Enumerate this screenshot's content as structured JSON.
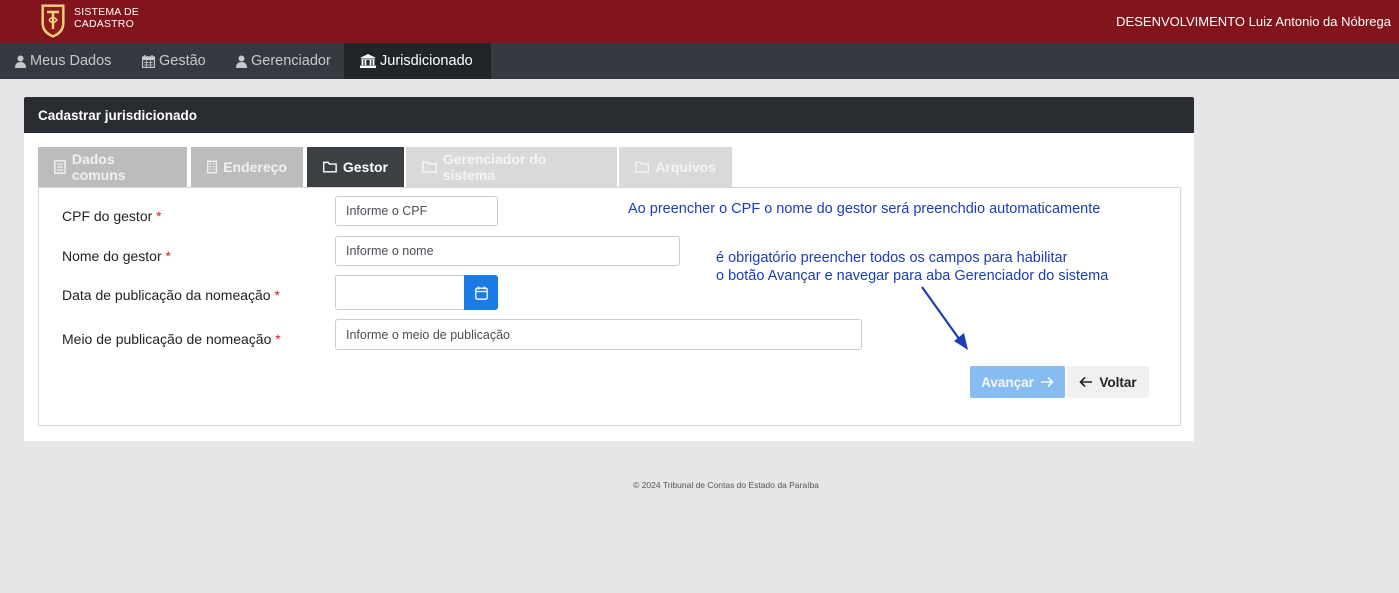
{
  "header": {
    "system_line1": "SISTEMA DE",
    "system_line2": "CADASTRO",
    "user": "DESENVOLVIMENTO Luiz Antonio da Nóbrega"
  },
  "nav": {
    "items": [
      {
        "label": "Meus Dados",
        "icon": "user-icon"
      },
      {
        "label": "Gestão",
        "icon": "calendar-icon"
      },
      {
        "label": "Gerenciador",
        "icon": "user-icon"
      },
      {
        "label": "Jurisdicionado",
        "icon": "bank-icon",
        "active": true
      }
    ]
  },
  "card": {
    "title": "Cadastrar jurisdicionado"
  },
  "tabs": [
    {
      "label": "Dados comuns",
      "icon": "document-icon"
    },
    {
      "label": "Endereço",
      "icon": "building-icon"
    },
    {
      "label": "Gestor",
      "icon": "folder-icon",
      "active": true
    },
    {
      "label": "Gerenciador do sistema",
      "icon": "folder-icon",
      "disabled": true
    },
    {
      "label": "Arquivos",
      "icon": "folder-icon",
      "disabled": true
    }
  ],
  "form": {
    "cpf_label": "CPF do gestor",
    "cpf_placeholder": "Informe o CPF",
    "nome_label": "Nome do gestor",
    "nome_placeholder": "Informe o nome",
    "data_label": "Data de publicação da nomeação",
    "data_value": "",
    "meio_label": "Meio de publicação de nomeação",
    "meio_placeholder": "Informe o meio de publicação",
    "required_mark": "*"
  },
  "notes": {
    "cpf_note": "Ao preencher o CPF o nome do gestor será preenchdio automaticamente",
    "required_note_line1": "é obrigatório preencher todos os campos para habilitar",
    "required_note_line2": "o botão Avançar e navegar para aba Gerenciador do sistema"
  },
  "actions": {
    "next_label": "Avançar",
    "back_label": "Voltar"
  },
  "footer": {
    "text": "© 2024 Tribunal de Contas do Estado da Paraíba"
  },
  "colors": {
    "header_bg": "#83141b",
    "nav_bg": "#343a40",
    "accent": "#1a7ae6",
    "note": "#1a3db8",
    "required": "#d32029"
  }
}
